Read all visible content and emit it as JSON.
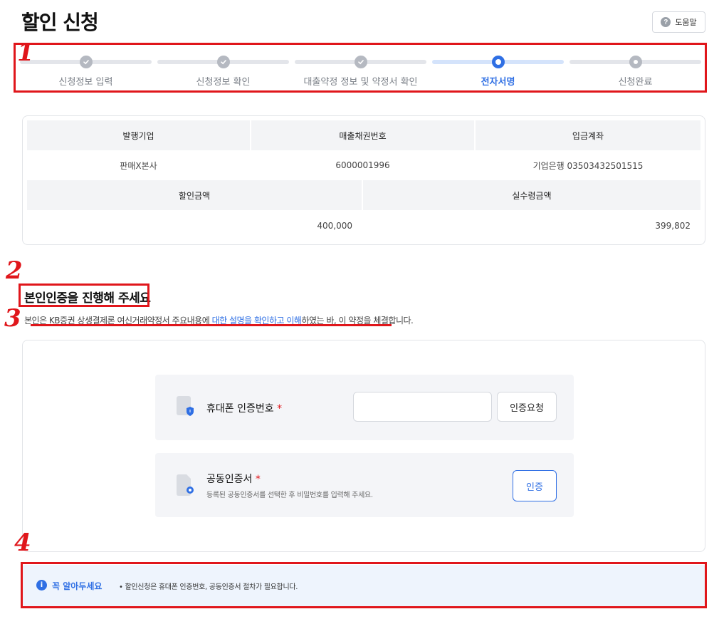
{
  "page": {
    "title": "할인 신청"
  },
  "help": {
    "label": "도움말"
  },
  "annotations": {
    "n1": "1",
    "n2": "2",
    "n3": "3",
    "n4": "4"
  },
  "stepper": {
    "steps": [
      {
        "label": "신청정보 입력",
        "state": "done"
      },
      {
        "label": "신청정보 확인",
        "state": "done"
      },
      {
        "label": "대출약정 정보 및 약정서 확인",
        "state": "done"
      },
      {
        "label": "전자서명",
        "state": "active"
      },
      {
        "label": "신청완료",
        "state": "pending"
      }
    ]
  },
  "info_table": {
    "row1_headers": [
      "발행기업",
      "매출채권번호",
      "입금계좌"
    ],
    "row1_values": [
      "판매X본사",
      "6000001996",
      "기업은행 03503432501515"
    ],
    "row2_headers": [
      "할인금액",
      "실수령금액"
    ],
    "row2_values": [
      "400,000",
      "399,802"
    ]
  },
  "section": {
    "title": "본인인증을 진행해 주세요",
    "notice_pre": "본인은 KB증권 상생결제론 여신거래약정서 주요내용에 ",
    "notice_link": "대한 설명을 확인하고 이해",
    "notice_post": "하였는 바, 이 약정을 체결합니다."
  },
  "auth": {
    "phone": {
      "title": "휴대폰 인증번호",
      "required_mark": "*",
      "input_value": "",
      "button": "인증요청"
    },
    "cert": {
      "title": "공동인증서",
      "required_mark": "*",
      "desc": "등록된 공동인증서를 선택한 후 비밀번호를 입력해 주세요.",
      "button": "인증"
    }
  },
  "must_know": {
    "title": "꼭 알아두세요",
    "item": "• 할인신청은 휴대폰 인증번호, 공동인증서 절차가 필요합니다."
  },
  "colors": {
    "accent": "#2f6fe4",
    "annotation": "#e0161b",
    "panel": "#f4f5f8"
  }
}
